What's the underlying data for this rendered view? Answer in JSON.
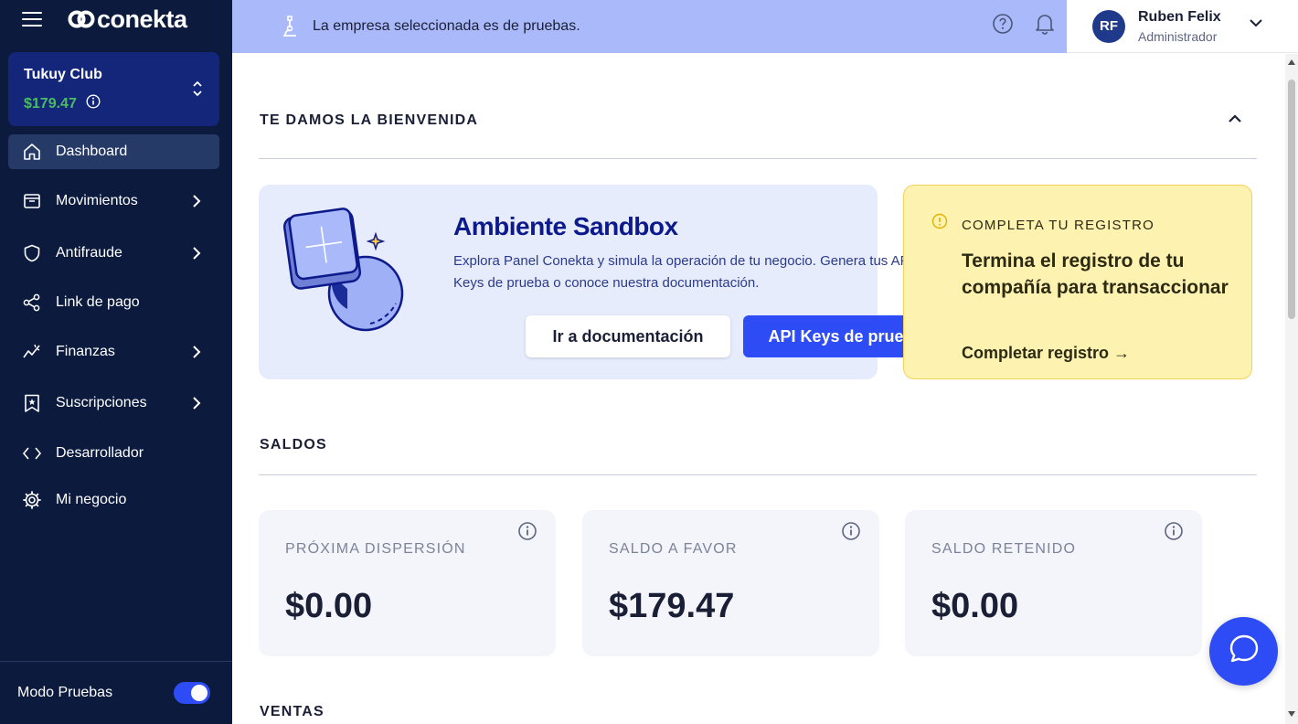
{
  "brand": {
    "name": "conekta"
  },
  "company": {
    "name": "Tukuy Club",
    "balance": "$179.47"
  },
  "nav": [
    {
      "label": "Dashboard",
      "icon": "home-icon",
      "active": true,
      "chevron": false
    },
    {
      "label": "Movimientos",
      "icon": "inbox-icon",
      "active": false,
      "chevron": true
    },
    {
      "label": "Antifraude",
      "icon": "shield-icon",
      "active": false,
      "chevron": true
    },
    {
      "label": "Link de pago",
      "icon": "share-icon",
      "active": false,
      "chevron": false
    },
    {
      "label": "Finanzas",
      "icon": "chart-line-icon",
      "active": false,
      "chevron": true
    },
    {
      "label": "Suscripciones",
      "icon": "bookmark-star-icon",
      "active": false,
      "chevron": true
    },
    {
      "label": "Desarrollador",
      "icon": "code-icon",
      "active": false,
      "chevron": false
    },
    {
      "label": "Mi negocio",
      "icon": "gear-icon",
      "active": false,
      "chevron": false
    }
  ],
  "footer": {
    "label": "Modo Pruebas",
    "enabled": true
  },
  "topbar": {
    "message": "La empresa seleccionada es de pruebas."
  },
  "user": {
    "initials": "RF",
    "name": "Ruben Felix",
    "role": "Administrador"
  },
  "welcome": {
    "title": "TE DAMOS LA BIENVENIDA"
  },
  "sandbox": {
    "title": "Ambiente Sandbox",
    "description": "Explora Panel Conekta y simula la operación de tu negocio. Genera tus API Keys de prueba o conoce nuestra documentación.",
    "docs_button": "Ir a documentación",
    "keys_button": "API Keys de prueba"
  },
  "registro": {
    "kicker": "COMPLETA TU REGISTRO",
    "title": "Termina el registro de tu compañía para transaccionar",
    "link": "Completar registro →"
  },
  "saldos": {
    "title": "SALDOS",
    "cards": [
      {
        "label": "PRÓXIMA DISPERSIÓN",
        "value": "$0.00"
      },
      {
        "label": "SALDO A FAVOR",
        "value": "$179.47"
      },
      {
        "label": "SALDO RETENIDO",
        "value": "$0.00"
      }
    ]
  },
  "ventas": {
    "title": "VENTAS"
  },
  "colors": {
    "sidebar": "#0b1a3d",
    "accent": "#2e4cf5",
    "topbar": "#a9b9fa",
    "positive": "#4cbb64"
  }
}
